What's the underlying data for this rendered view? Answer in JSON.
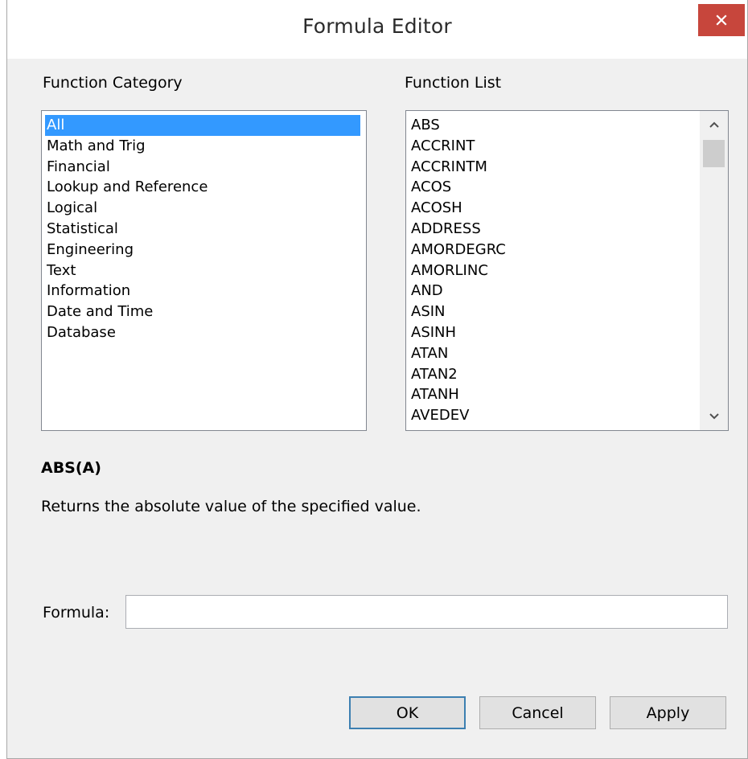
{
  "window": {
    "title": "Formula Editor",
    "close_label": "×"
  },
  "category": {
    "label": "Function Category",
    "items": [
      "All",
      "Math and Trig",
      "Financial",
      "Lookup and Reference",
      "Logical",
      "Statistical",
      "Engineering",
      "Text",
      "Information",
      "Date and Time",
      "Database"
    ],
    "selected": "All"
  },
  "functions": {
    "label": "Function List",
    "items": [
      "ABS",
      "ACCRINT",
      "ACCRINTM",
      "ACOS",
      "ACOSH",
      "ADDRESS",
      "AMORDEGRC",
      "AMORLINC",
      "AND",
      "ASIN",
      "ASINH",
      "ATAN",
      "ATAN2",
      "ATANH",
      "AVEDEV"
    ],
    "scroll_up_icon": "chevron-up-icon",
    "scroll_down_icon": "chevron-down-icon"
  },
  "detail": {
    "signature": "ABS(A)",
    "description": "Returns the absolute value of the specified value."
  },
  "formula": {
    "label": "Formula:",
    "value": ""
  },
  "buttons": {
    "ok": "OK",
    "cancel": "Cancel",
    "apply": "Apply"
  },
  "colors": {
    "selection": "#3399ff",
    "close_button": "#c7463c",
    "dialog_background": "#f0f0f0"
  }
}
